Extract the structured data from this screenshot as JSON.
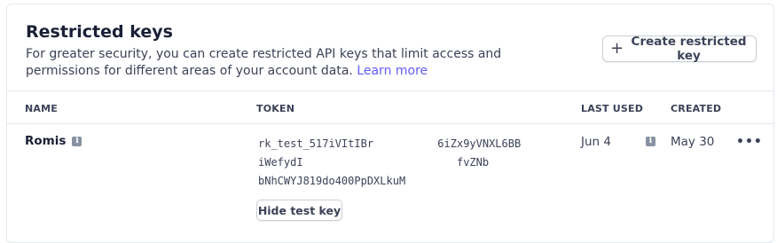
{
  "header": {
    "title": "Restricted keys",
    "description": "For greater security, you can create restricted API keys that limit access and permissions for different areas of your account data.",
    "learn_more": "Learn more",
    "create_button_label": "Create restricted key"
  },
  "table": {
    "columns": {
      "name": "NAME",
      "token": "TOKEN",
      "last_used": "LAST USED",
      "created": "CREATED"
    },
    "rows": [
      {
        "name": "Romis",
        "token_lines": [
          "rk_test_517iVItIBr          6iZx9yVNXL6BB",
          "iWefydI                        fvZNb",
          "bNhCWYJ819do400PpDXLkuM"
        ],
        "last_used": "Jun 4",
        "created": "May 30",
        "hide_button_label": "Hide test key"
      }
    ]
  },
  "icons": {
    "plus": "plus-icon",
    "info": "info-icon",
    "more": "more-horizontal-icon"
  },
  "colors": {
    "accent_link": "#635bff",
    "border": "#e3e8ee",
    "text_primary": "#1a1f36",
    "text_secondary": "#3c4257",
    "info_icon": "#8792a2"
  }
}
